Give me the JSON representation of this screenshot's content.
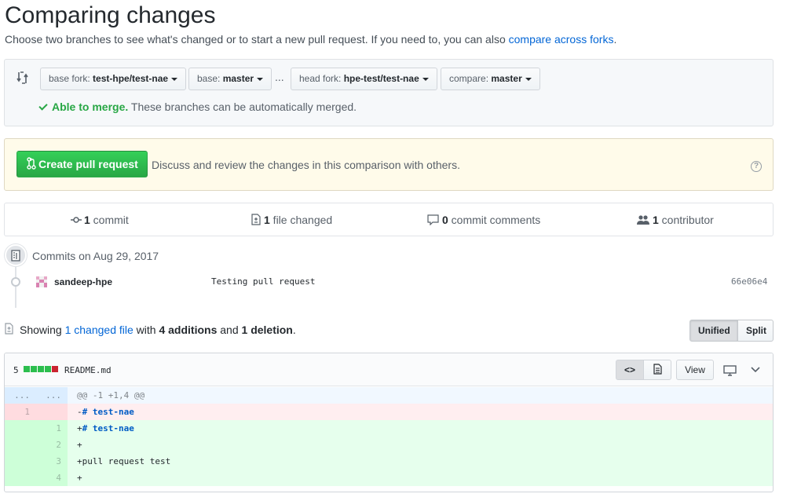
{
  "page": {
    "title": "Comparing changes",
    "subtitle": "Choose two branches to see what's changed or to start a new pull request. If you need to, you can also ",
    "subtitle_link": "compare across forks",
    "subtitle_end": "."
  },
  "range": {
    "base_fork_label": "base fork:",
    "base_fork_value": "test-hpe/test-nae",
    "base_label": "base:",
    "base_value": "master",
    "dots": "...",
    "head_fork_label": "head fork:",
    "head_fork_value": "hpe-test/test-nae",
    "compare_label": "compare:",
    "compare_value": "master",
    "merge_ok": "Able to merge.",
    "merge_text": " These branches can be automatically merged."
  },
  "pr": {
    "button_label": "Create pull request",
    "description": "Discuss and review the changes in this comparison with others.",
    "help": "?"
  },
  "stats": {
    "commits_count": "1",
    "commits_label": " commit",
    "files_count": "1",
    "files_label": " file changed",
    "comments_count": "0",
    "comments_label": " commit comments",
    "contributors_count": "1",
    "contributors_label": " contributor"
  },
  "commits": {
    "date_header": "Commits on Aug 29, 2017",
    "items": [
      {
        "author": "sandeep-hpe",
        "message": "Testing pull request",
        "sha": "66e06e4"
      }
    ]
  },
  "diffstat": {
    "prefix": "Showing ",
    "changed_link": "1 changed file",
    "mid": " with ",
    "additions": "4 additions",
    "and": " and ",
    "deletions": "1 deletion",
    "end": ".",
    "unified_label": "Unified",
    "split_label": "Split",
    "selected": "Unified"
  },
  "file": {
    "change_count": "5",
    "name": "README.md",
    "view_label": "View",
    "hunk_old": "...",
    "hunk_new": "...",
    "hunk_header": "@@ -1 +1,4 @@",
    "lines": [
      {
        "old": "1",
        "new": "",
        "type": "del",
        "text": "-# test-nae"
      },
      {
        "old": "",
        "new": "1",
        "type": "add",
        "text": "+# test-nae"
      },
      {
        "old": "",
        "new": "2",
        "type": "add",
        "text": "+"
      },
      {
        "old": "",
        "new": "3",
        "type": "add",
        "text": "+pull request test"
      },
      {
        "old": "",
        "new": "4",
        "type": "add",
        "text": "+"
      }
    ]
  },
  "colors": {
    "add_bg": "#e6ffed",
    "add_num_bg": "#cdffd8",
    "del_bg": "#ffeef0",
    "del_num_bg": "#ffdce0",
    "hunk_bg": "#f1f8ff",
    "hunk_num_bg": "#dbedff",
    "green": "#28a745",
    "red": "#cb2431",
    "link": "#0366d6"
  }
}
